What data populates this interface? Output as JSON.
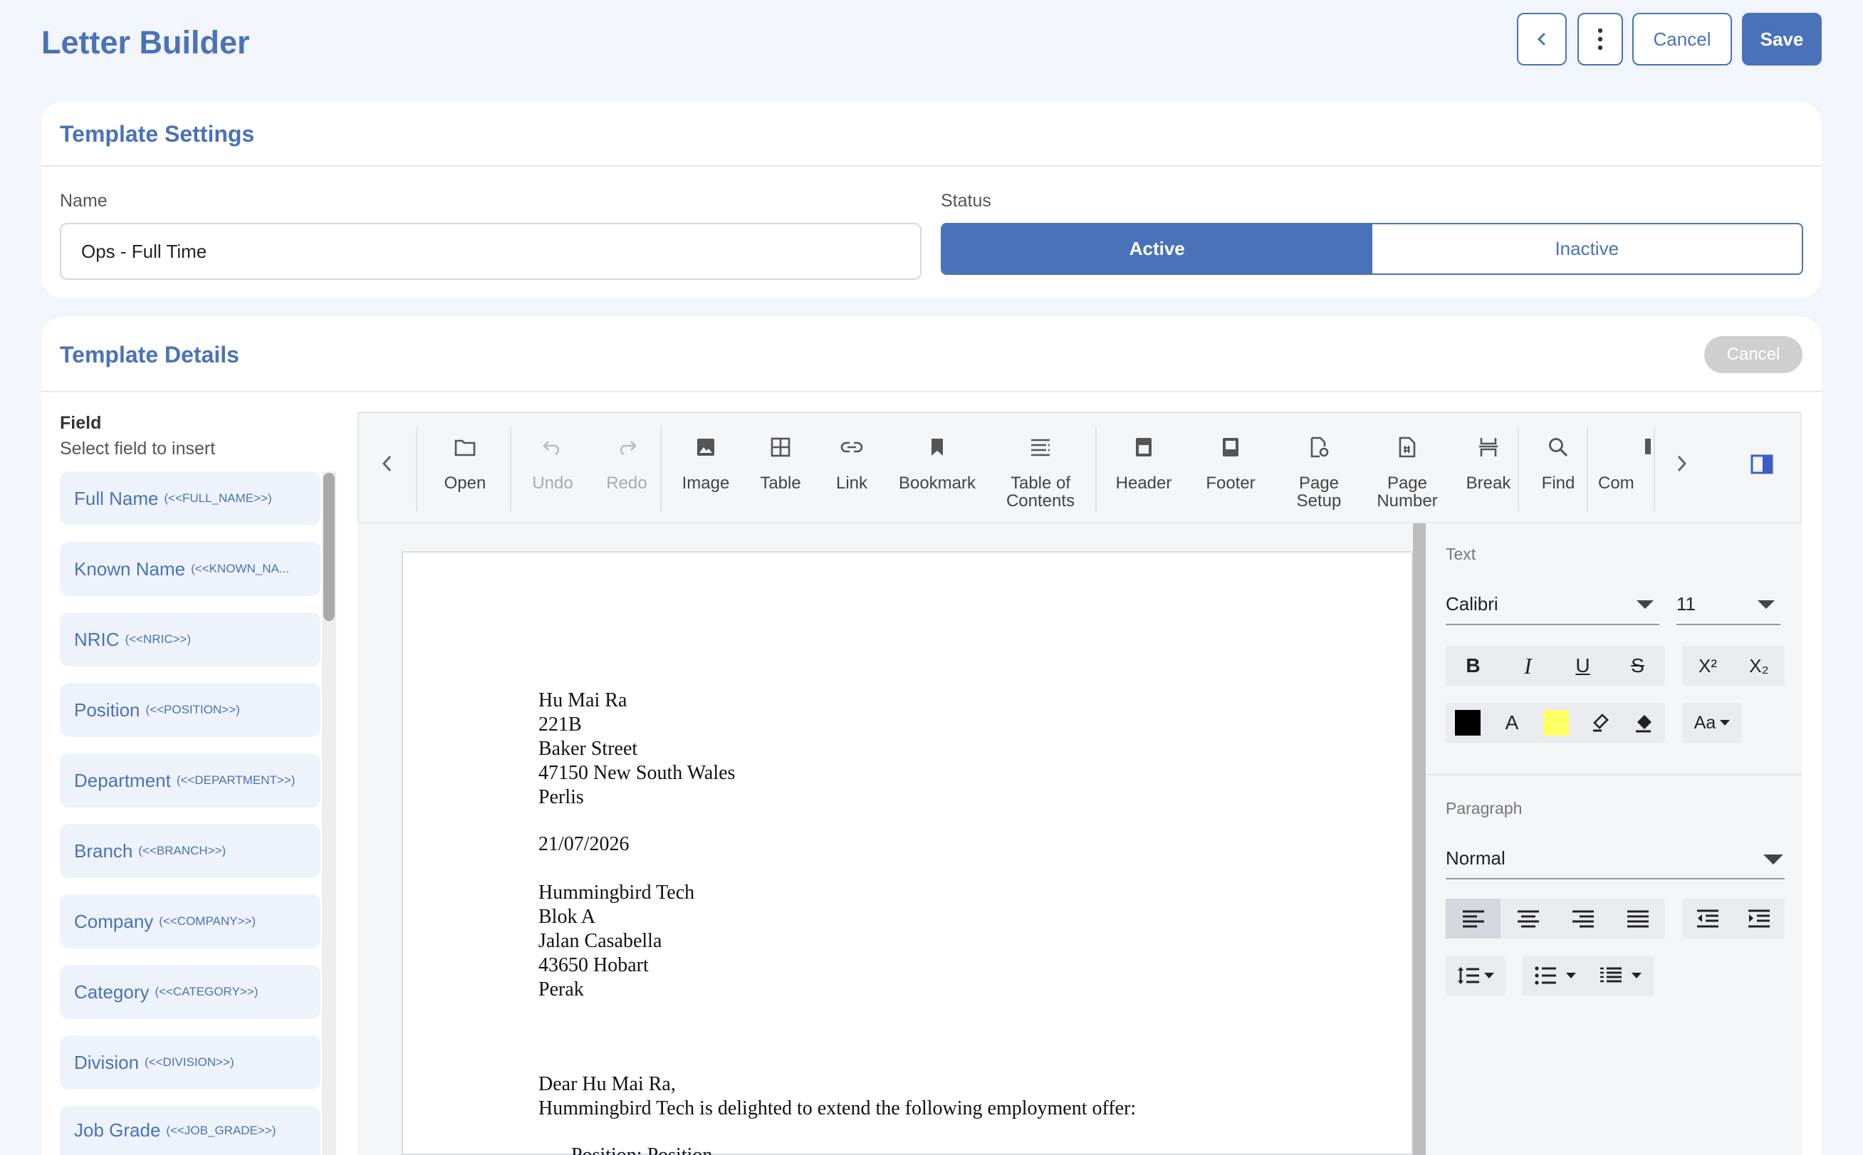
{
  "header": {
    "title": "Letter Builder",
    "cancel_label": "Cancel",
    "save_label": "Save"
  },
  "template_settings": {
    "title": "Template Settings",
    "name_label": "Name",
    "name_value": "Ops - Full Time",
    "status_label": "Status",
    "status_options": [
      "Active",
      "Inactive"
    ],
    "status_selected": "Active"
  },
  "template_details": {
    "title": "Template Details",
    "cancel_label": "Cancel",
    "field_title": "Field",
    "field_subtitle": "Select field to insert",
    "fields": [
      {
        "name": "Full Name",
        "token": "(<<FULL_NAME>>)"
      },
      {
        "name": "Known Name",
        "token": "(<<KNOWN_NA..."
      },
      {
        "name": "NRIC",
        "token": "(<<NRIC>>)"
      },
      {
        "name": "Position",
        "token": "(<<POSITION>>)"
      },
      {
        "name": "Department",
        "token": "(<<DEPARTMENT>>)"
      },
      {
        "name": "Branch",
        "token": "(<<BRANCH>>)"
      },
      {
        "name": "Company",
        "token": "(<<COMPANY>>)"
      },
      {
        "name": "Category",
        "token": "(<<CATEGORY>>)"
      },
      {
        "name": "Division",
        "token": "(<<DIVISION>>)"
      },
      {
        "name": "Job Grade",
        "token": "(<<JOB_GRADE>>)"
      }
    ]
  },
  "toolbar": {
    "open": "Open",
    "undo": "Undo",
    "redo": "Redo",
    "image": "Image",
    "table": "Table",
    "link": "Link",
    "bookmark": "Bookmark",
    "toc_1": "Table of",
    "toc_2": "Contents",
    "header": "Header",
    "footer": "Footer",
    "page_setup_1": "Page",
    "page_setup_2": "Setup",
    "page_number_1": "Page",
    "page_number_2": "Number",
    "break": "Break",
    "find": "Find",
    "comments": "Com"
  },
  "document": {
    "recipient": [
      "Hu Mai Ra",
      "221B",
      "Baker Street",
      "47150 New South Wales",
      "Perlis"
    ],
    "date": "21/07/2026",
    "company_address": [
      "Hummingbird Tech",
      "Blok A",
      "Jalan Casabella",
      "43650 Hobart",
      "Perak"
    ],
    "salutation": "Dear Hu Mai Ra,",
    "intro": "Hummingbird Tech is delighted to extend the following employment offer:",
    "bullet_1": "Position: Position"
  },
  "side_panel": {
    "text_label": "Text",
    "font": "Calibri",
    "font_size": "11",
    "bold": "B",
    "italic": "I",
    "underline": "U",
    "strike": "S",
    "superscript": "X²",
    "subscript": "X₂",
    "font_color_glyph": "A",
    "case_label": "Aa",
    "paragraph_label": "Paragraph",
    "paragraph_style": "Normal"
  },
  "colors": {
    "accent": "#4a72b8",
    "font_color": "#000000",
    "highlight": "#ffff66"
  }
}
